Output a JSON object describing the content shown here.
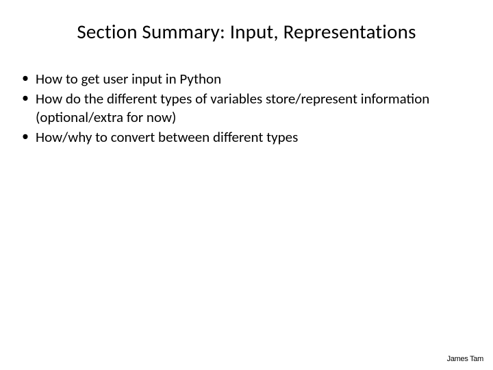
{
  "title": "Section Summary: Input, Representations",
  "bullets": [
    "How to get user input in Python",
    "How do the different types of variables store/represent information (optional/extra for now)",
    "How/why to convert between different types"
  ],
  "footer": "James Tam"
}
